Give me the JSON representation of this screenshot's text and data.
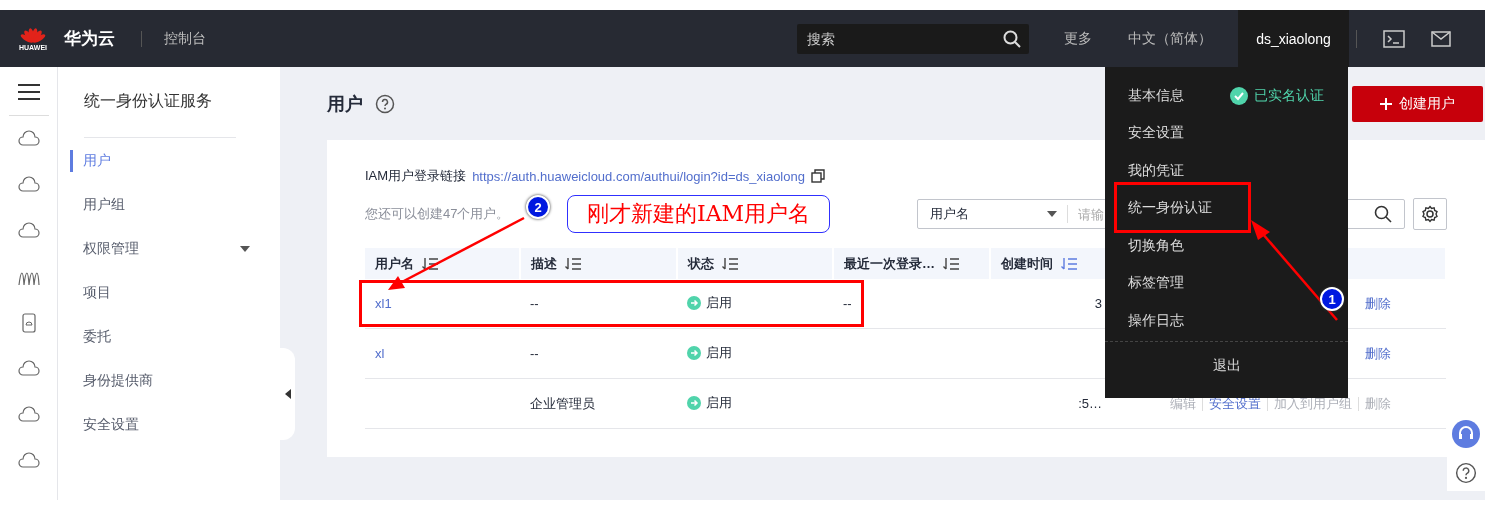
{
  "header": {
    "logo_text": "HUAWEI",
    "brand": "华为云",
    "console": "控制台",
    "search": {
      "placeholder": "搜索"
    },
    "links": [
      "更多",
      "中文（简体）"
    ],
    "user": "ds_xiaolong"
  },
  "user_menu": {
    "items": [
      {
        "label": "基本信息",
        "badge": "已实名认证"
      },
      {
        "label": "安全设置"
      },
      {
        "label": "我的凭证"
      },
      {
        "label": "统一身份认证"
      },
      {
        "label": "切换角色"
      },
      {
        "label": "标签管理"
      },
      {
        "label": "操作日志"
      }
    ],
    "logout": "退出"
  },
  "sidebar": {
    "title": "统一身份认证服务",
    "items": [
      {
        "label": "用户",
        "selected": true,
        "expandable": false
      },
      {
        "label": "用户组",
        "selected": false,
        "expandable": false
      },
      {
        "label": "权限管理",
        "selected": false,
        "expandable": true
      },
      {
        "label": "项目",
        "selected": false,
        "expandable": false
      },
      {
        "label": "委托",
        "selected": false,
        "expandable": false
      },
      {
        "label": "身份提供商",
        "selected": false,
        "expandable": false
      },
      {
        "label": "安全设置",
        "selected": false,
        "expandable": false
      }
    ]
  },
  "page": {
    "title": "用户",
    "create_button": "创建用户",
    "login_label": "IAM用户登录链接",
    "login_link": "https://auth.huaweicloud.com/authui/login?id=ds_xiaolong",
    "quota_note": "您还可以创建47个用户。",
    "filter": {
      "field": "用户名",
      "placeholder": "请输"
    }
  },
  "table": {
    "columns": [
      {
        "label": "用户名",
        "sort_active": false
      },
      {
        "label": "描述",
        "sort_active": false
      },
      {
        "label": "状态",
        "sort_active": false
      },
      {
        "label": "最近一次登录…",
        "sort_active": false
      },
      {
        "label": "创建时间",
        "sort_active": true
      }
    ],
    "rows": [
      {
        "username": "xl1",
        "description": "--",
        "status": "启用",
        "last_login": "--",
        "created": "3",
        "actions": [
          {
            "label": "删除",
            "disabled": false
          }
        ]
      },
      {
        "username": "xl",
        "description": "--",
        "status": "启用",
        "actions": [
          {
            "label": "删除",
            "disabled": false
          }
        ]
      },
      {
        "description": "企业管理员",
        "status": "启用",
        "created": ":5…",
        "actions": [
          {
            "label": "编辑",
            "disabled": true
          },
          {
            "label": "安全设置",
            "disabled": false
          },
          {
            "label": "加入到用户组",
            "disabled": true
          },
          {
            "label": "删除",
            "disabled": true
          }
        ]
      }
    ]
  },
  "annotations": {
    "callout": "刚才新建的IAM用户名",
    "markers": [
      "1",
      "2"
    ]
  }
}
